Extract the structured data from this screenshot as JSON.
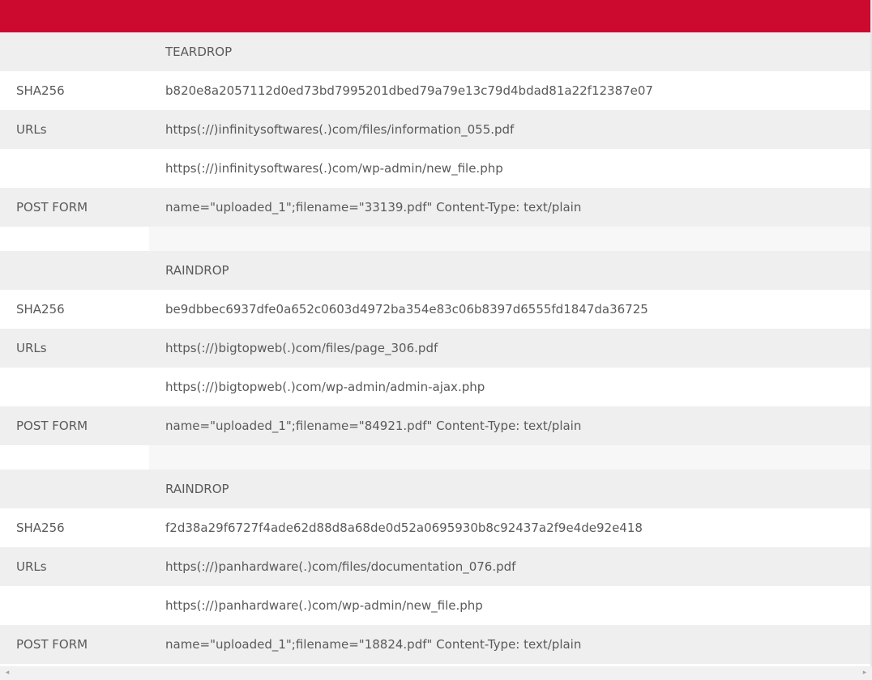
{
  "colors": {
    "header": "#cc0a2f",
    "row_grey": "#efefef",
    "row_white": "#ffffff",
    "text": "#5a5a5a"
  },
  "rows": [
    {
      "type": "grey",
      "label": "",
      "value": "TEARDROP"
    },
    {
      "type": "white",
      "label": "SHA256",
      "value": "b820e8a2057112d0ed73bd7995201dbed79a79e13c79d4bdad81a22f12387e07"
    },
    {
      "type": "grey",
      "label": "URLs",
      "value": "https(://)infinitysoftwares(.)com/files/information_055.pdf"
    },
    {
      "type": "white",
      "label": "",
      "value": "https(://)infinitysoftwares(.)com/wp-admin/new_file.php"
    },
    {
      "type": "grey",
      "label": "POST FORM",
      "value": "name=\"uploaded_1\";filename=\"33139.pdf\" Content-Type: text/plain"
    },
    {
      "type": "spacer",
      "label": "",
      "value": ""
    },
    {
      "type": "grey",
      "label": "",
      "value": "RAINDROP"
    },
    {
      "type": "white",
      "label": "SHA256",
      "value": "be9dbbec6937dfe0a652c0603d4972ba354e83c06b8397d6555fd1847da36725"
    },
    {
      "type": "grey",
      "label": "URLs",
      "value": "https(://)bigtopweb(.)com/files/page_306.pdf"
    },
    {
      "type": "white",
      "label": "",
      "value": "https(://)bigtopweb(.)com/wp-admin/admin-ajax.php"
    },
    {
      "type": "grey",
      "label": "POST FORM",
      "value": "name=\"uploaded_1\";filename=\"84921.pdf\" Content-Type: text/plain"
    },
    {
      "type": "spacer",
      "label": "",
      "value": ""
    },
    {
      "type": "grey",
      "label": "",
      "value": "RAINDROP"
    },
    {
      "type": "white",
      "label": "SHA256",
      "value": "f2d38a29f6727f4ade62d88d8a68de0d52a0695930b8c92437a2f9e4de92e418"
    },
    {
      "type": "grey",
      "label": "URLs",
      "value": "https(://)panhardware(.)com/files/documentation_076.pdf"
    },
    {
      "type": "white",
      "label": "",
      "value": "https(://)panhardware(.)com/wp-admin/new_file.php"
    },
    {
      "type": "grey",
      "label": "POST FORM",
      "value": "name=\"uploaded_1\";filename=\"18824.pdf\" Content-Type: text/plain"
    }
  ],
  "scrollbar": {
    "left_arrow_icon": "◂",
    "right_arrow_icon": "▸"
  }
}
